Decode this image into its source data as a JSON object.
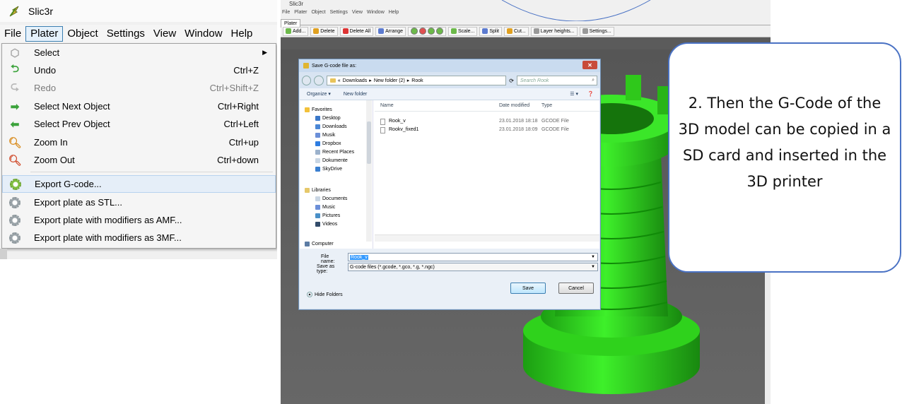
{
  "left_window": {
    "title": "Slic3r",
    "menubar": [
      "File",
      "Plater",
      "Object",
      "Settings",
      "View",
      "Window",
      "Help"
    ],
    "active_menu": "Plater",
    "menu_items": [
      {
        "label": "Select",
        "shortcut": "",
        "icon": "cube-icon",
        "submenu": true,
        "disabled": false
      },
      {
        "label": "Undo",
        "shortcut": "Ctrl+Z",
        "icon": "undo-icon",
        "disabled": false
      },
      {
        "label": "Redo",
        "shortcut": "Ctrl+Shift+Z",
        "icon": "redo-icon",
        "disabled": true
      },
      {
        "label": "Select Next Object",
        "shortcut": "Ctrl+Right",
        "icon": "arrow-right-icon",
        "disabled": false
      },
      {
        "label": "Select Prev Object",
        "shortcut": "Ctrl+Left",
        "icon": "arrow-left-icon",
        "disabled": false
      },
      {
        "label": "Zoom In",
        "shortcut": "Ctrl+up",
        "icon": "zoom-in-icon",
        "disabled": false
      },
      {
        "label": "Zoom Out",
        "shortcut": "Ctrl+down",
        "icon": "zoom-out-icon",
        "disabled": false
      },
      {
        "label": "Export G-code...",
        "shortcut": "",
        "icon": "gear-green-icon",
        "highlighted": true
      },
      {
        "label": "Export plate as STL...",
        "shortcut": "",
        "icon": "gear-icon"
      },
      {
        "label": "Export plate with modifiers as AMF...",
        "shortcut": "",
        "icon": "gear-icon"
      },
      {
        "label": "Export plate with modifiers as 3MF...",
        "shortcut": "",
        "icon": "gear-icon"
      }
    ]
  },
  "right_window": {
    "title": "Slic3r",
    "menubar": "File  Plater  Object  Settings  View  Window  Help",
    "tab": "Plater",
    "toolbar": [
      "Add...",
      "Delete",
      "Delete All",
      "Arrange",
      "Scale...",
      "Split",
      "Cut...",
      "Layer heights...",
      "Settings..."
    ]
  },
  "save_dialog": {
    "title": "Save G-code file as:",
    "breadcrumb": [
      "«",
      "Downloads",
      "New folder (2)",
      "Rook"
    ],
    "search_placeholder": "Search Rook",
    "organize": "Organize ▾",
    "new_folder": "New folder",
    "nav": {
      "favorites_label": "Favorites",
      "favorites": [
        "Desktop",
        "Downloads",
        "Musik",
        "Dropbox",
        "Recent Places",
        "Dokumente",
        "SkyDrive"
      ],
      "libraries_label": "Libraries",
      "libraries": [
        "Documents",
        "Music",
        "Pictures",
        "Videos"
      ],
      "computer_label": "Computer"
    },
    "columns": [
      "Name",
      "Date modified",
      "Type"
    ],
    "files": [
      {
        "name": "Rook_v",
        "date": "23.01.2018 18:18",
        "type": "GCODE File"
      },
      {
        "name": "Rookv_fixed1",
        "date": "23.01.2018 18:09",
        "type": "GCODE File"
      }
    ],
    "file_name_label": "File name:",
    "file_name_value": "Rook_v",
    "save_type_label": "Save as type:",
    "save_type_value": "G-code files (*.gcode, *.gco, *.g, *.ngc)",
    "hide_folders": "Hide Folders",
    "save_button": "Save",
    "cancel_button": "Cancel"
  },
  "callout": {
    "text": "2. Then the G-Code of the 3D model can be copied in a SD card and inserted in the 3D printer"
  },
  "colors": {
    "callout_border": "#4a72c4",
    "menu_highlight": "#e5eef8",
    "model_green": "#35e01f",
    "viewport_bg": "#5b5b5b"
  }
}
